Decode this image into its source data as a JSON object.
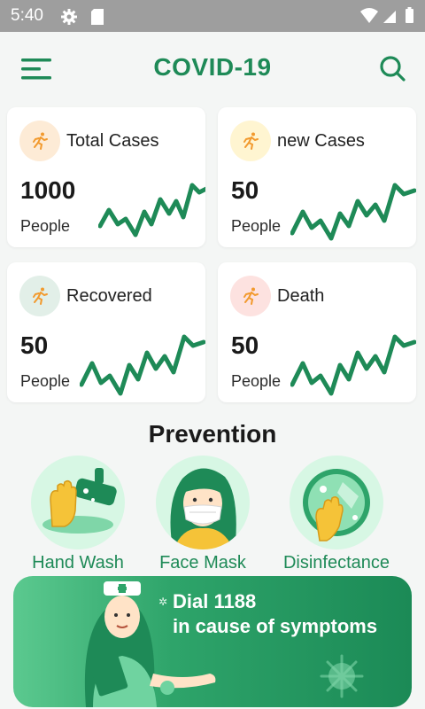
{
  "status_bar": {
    "time": "5:40"
  },
  "app_bar": {
    "title": "COVID-19"
  },
  "cards": [
    {
      "label": "Total Cases",
      "value": "1000",
      "unit": "People"
    },
    {
      "label": "new Cases",
      "value": "50",
      "unit": "People"
    },
    {
      "label": "Recovered",
      "value": "50",
      "unit": "People"
    },
    {
      "label": "Death",
      "value": "50",
      "unit": "People"
    }
  ],
  "prevention": {
    "title": "Prevention",
    "items": [
      {
        "label": "Hand Wash"
      },
      {
        "label": "Face Mask"
      },
      {
        "label": "Disinfectance"
      }
    ]
  },
  "banner": {
    "line1": "Dial 1188",
    "line2": "in cause of symptoms"
  },
  "colors": {
    "primary": "#1e8a57",
    "icon_orange": "#f29a2e",
    "status_bar": "#9e9e9e"
  }
}
